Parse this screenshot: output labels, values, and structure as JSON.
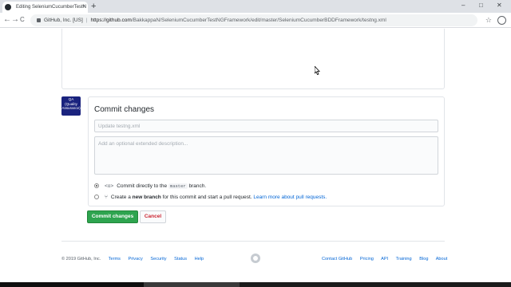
{
  "browser": {
    "tab_title": "Editing SeleniumCucumberTestN",
    "tab_close": "×",
    "new_tab": "+",
    "window_controls": [
      "–",
      "□",
      "✕"
    ],
    "nav": [
      "←",
      "→",
      "C"
    ],
    "secure_label": "GitHub, Inc. [US]",
    "url_host": "https://github.com",
    "url_path": "/BakkappaN/SeleniumCucumberTestNGFramework/edit/master/SeleniumCucumberBDDFramework/testng.xml",
    "bookmark_icon": "star-icon",
    "profile_icon": "profile-icon"
  },
  "avatar": {
    "line1": "QA",
    "line2": "(Quality",
    "line3": "Assurance)"
  },
  "commit": {
    "title": "Commit changes",
    "summary_placeholder": "Update testng.xml",
    "description_placeholder": "Add an optional extended description...",
    "option_direct_prefix": "Commit directly to the",
    "option_direct_branch": "master",
    "option_direct_suffix": "branch.",
    "option_new_create": "Create a",
    "option_new_bold": "new branch",
    "option_new_rest": "for this commit and start a pull request.",
    "option_new_link": "Learn more about pull requests.",
    "commit_button": "Commit changes",
    "cancel_button": "Cancel"
  },
  "footer": {
    "copyright": "© 2019 GitHub, Inc.",
    "left_links": [
      "Terms",
      "Privacy",
      "Security",
      "Status",
      "Help"
    ],
    "right_links": [
      "Contact GitHub",
      "Pricing",
      "API",
      "Training",
      "Blog",
      "About"
    ]
  }
}
